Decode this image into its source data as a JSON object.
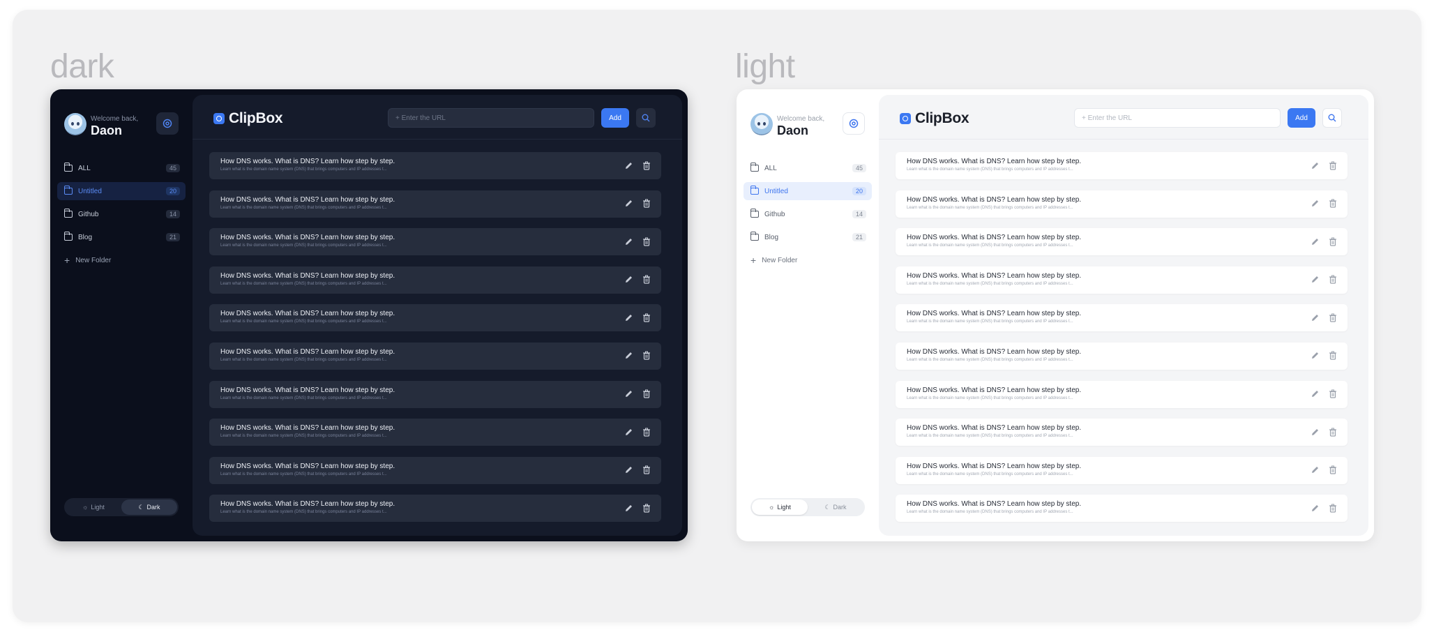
{
  "labels": {
    "dark": "dark",
    "light": "light"
  },
  "user": {
    "welcome": "Welcome back,",
    "name": "Daon"
  },
  "folders": [
    {
      "label": "ALL",
      "count": "45"
    },
    {
      "label": "Untitled",
      "count": "20"
    },
    {
      "label": "Github",
      "count": "14"
    },
    {
      "label": "Blog",
      "count": "21"
    }
  ],
  "new_folder": "New Folder",
  "theme_toggle": {
    "light": "Light",
    "dark": "Dark"
  },
  "header": {
    "logo": "ClipBox",
    "url_placeholder": "+ Enter the URL",
    "add": "Add"
  },
  "item": {
    "title": "How DNS works. What is DNS? Learn how step by step.",
    "desc": "Learn what is the domain name system (DNS) that brings computers and IP addresses t..."
  },
  "colors": {
    "accent": "#3b78f2",
    "dark_bg": "#0b0f1c",
    "dark_panel": "#151b2b",
    "light_panel": "#f4f5f7"
  }
}
